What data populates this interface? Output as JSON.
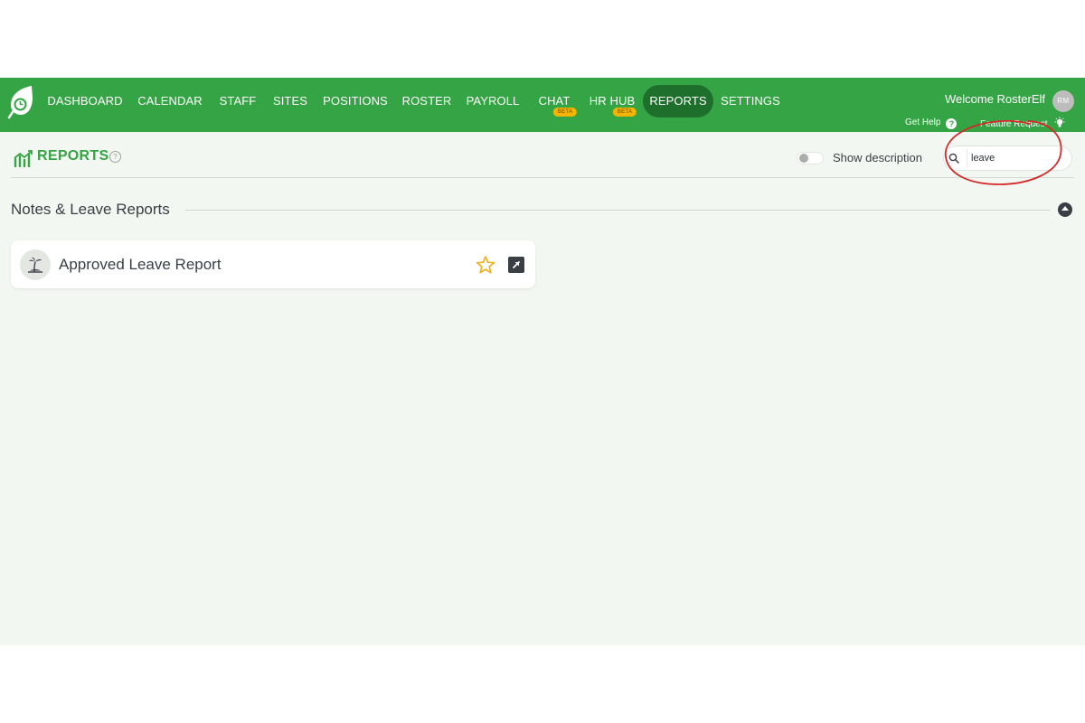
{
  "nav": {
    "items": [
      {
        "label": "DASHBOARD"
      },
      {
        "label": "CALENDAR"
      },
      {
        "label": "STAFF"
      },
      {
        "label": "SITES"
      },
      {
        "label": "POSITIONS"
      },
      {
        "label": "ROSTER"
      },
      {
        "label": "PAYROLL"
      },
      {
        "label": "CHAT",
        "badge": "BETA"
      },
      {
        "label": "HR HUB",
        "badge": "BETA"
      },
      {
        "label": "REPORTS",
        "active": true
      },
      {
        "label": "SETTINGS"
      }
    ]
  },
  "user": {
    "welcome": "Welcome RosterElf",
    "initials": "RM"
  },
  "links": {
    "help": "Get Help",
    "feature": "Feature Request"
  },
  "page": {
    "title": "REPORTS",
    "toggle_label": "Show description",
    "search_value": "leave"
  },
  "section": {
    "title": "Notes & Leave Reports"
  },
  "reports": [
    {
      "title": "Approved Leave Report"
    }
  ],
  "colors": {
    "brand": "#34a444",
    "nav_active": "#1e6f2b",
    "beta_badge": "#f4b400",
    "background": "#f2f7f1",
    "star": "#f2b01e",
    "annotation": "#d62828"
  }
}
